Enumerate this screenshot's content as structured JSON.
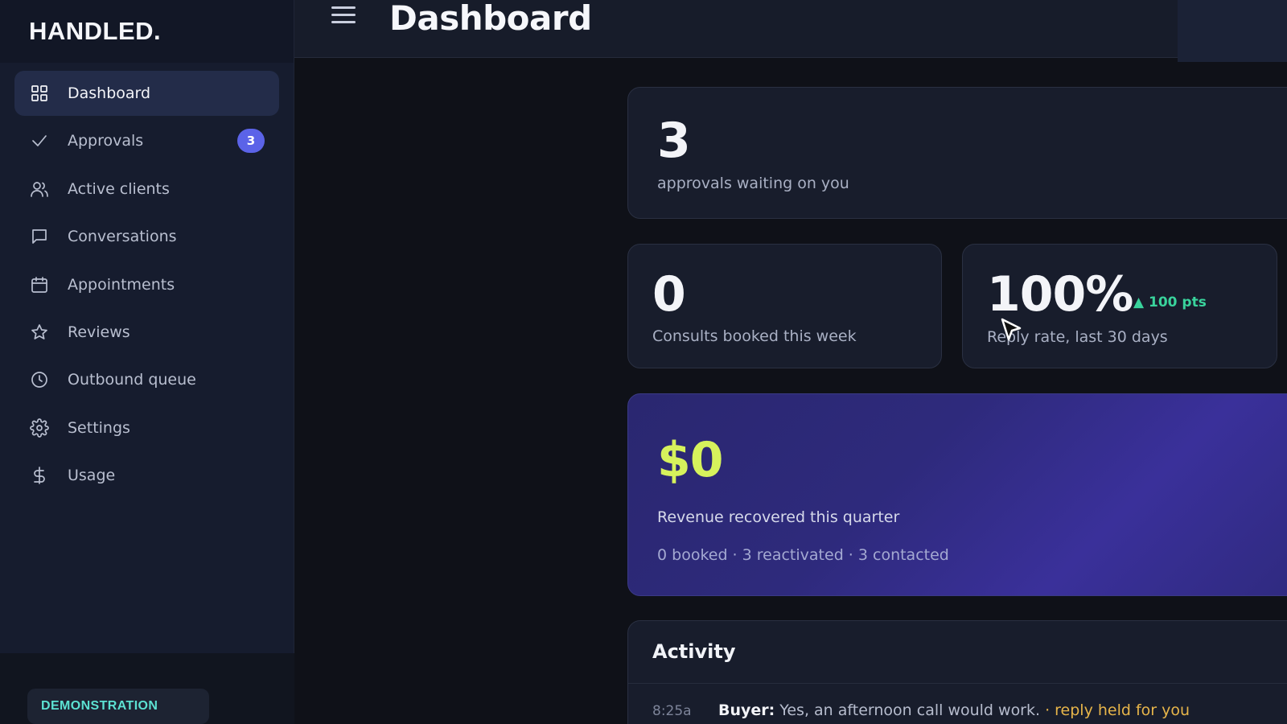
{
  "brand": {
    "name": "HANDLED."
  },
  "sidebar": {
    "items": [
      {
        "label": "Dashboard",
        "icon": "grid-icon",
        "active": true
      },
      {
        "label": "Approvals",
        "icon": "check-icon",
        "badge": "3"
      },
      {
        "label": "Active clients",
        "icon": "users-icon"
      },
      {
        "label": "Conversations",
        "icon": "chat-icon"
      },
      {
        "label": "Appointments",
        "icon": "calendar-icon"
      },
      {
        "label": "Reviews",
        "icon": "star-icon"
      },
      {
        "label": "Outbound queue",
        "icon": "clock-icon"
      },
      {
        "label": "Settings",
        "icon": "gear-icon"
      },
      {
        "label": "Usage",
        "icon": "dollar-icon"
      }
    ],
    "footer": {
      "mode_label": "DEMONSTRATION"
    }
  },
  "header": {
    "title": "Dashboard"
  },
  "stats": {
    "approvals": {
      "value": "3",
      "label": "approvals waiting on you"
    },
    "consults": {
      "value": "0",
      "label": "Consults booked this week"
    },
    "reply_rate": {
      "value": "100%",
      "delta": "▲ 100 pts",
      "label": "Reply rate, last 30 days"
    },
    "revenue": {
      "value": "$0",
      "label": "Revenue recovered this quarter",
      "breakdown": "0 booked · 3 reactivated · 3 contacted"
    }
  },
  "activity": {
    "title": "Activity",
    "rows": [
      {
        "time": "8:25a",
        "actor": "Buyer:",
        "message": " Yes, an afternoon call would work.",
        "note": " · reply held for you"
      }
    ]
  },
  "colors": {
    "accent": "#5b63e8",
    "positive": "#39d39c",
    "revenue_highlight": "#d6f25c",
    "note": "#e7b54a",
    "demo_label": "#5ce1d2"
  }
}
